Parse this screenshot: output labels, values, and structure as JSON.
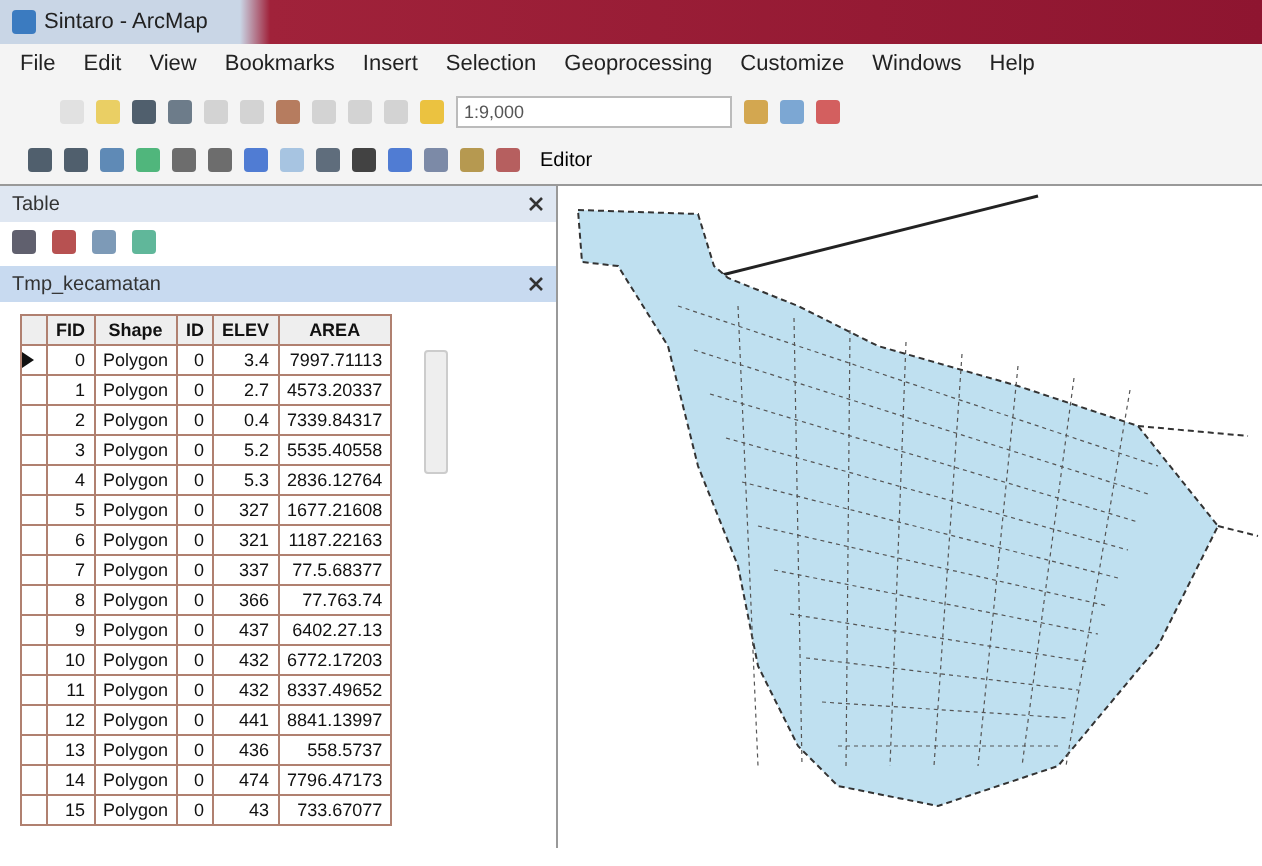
{
  "window": {
    "title": "Sintaro - ArcMap"
  },
  "menu": [
    "File",
    "Edit",
    "View",
    "Bookmarks",
    "Insert",
    "Selection",
    "Geoprocessing",
    "Customize",
    "Windows",
    "Help"
  ],
  "toolbar": {
    "scale": "1:9,000",
    "editor": "Editor"
  },
  "table_window": {
    "title": "Table",
    "tab": "Tmp_kecamatan",
    "columns": [
      "FID",
      "Shape",
      "ID",
      "ELEV",
      "AREA"
    ],
    "rows": [
      {
        "current": true,
        "cells": [
          "0",
          "Polygon",
          "0",
          "3.4",
          "7997.71113"
        ]
      },
      {
        "current": false,
        "cells": [
          "1",
          "Polygon",
          "0",
          "2.7",
          "4573.20337"
        ]
      },
      {
        "current": false,
        "cells": [
          "2",
          "Polygon",
          "0",
          "0.4",
          "7339.84317"
        ]
      },
      {
        "current": false,
        "cells": [
          "3",
          "Polygon",
          "0",
          "5.2",
          "5535.40558"
        ]
      },
      {
        "current": false,
        "cells": [
          "4",
          "Polygon",
          "0",
          "5.3",
          "2836.12764"
        ]
      },
      {
        "current": false,
        "cells": [
          "5",
          "Polygon",
          "0",
          "327",
          "1677.21608"
        ]
      },
      {
        "current": false,
        "cells": [
          "6",
          "Polygon",
          "0",
          "321",
          "1187.22163"
        ]
      },
      {
        "current": false,
        "cells": [
          "7",
          "Polygon",
          "0",
          "337",
          "77.5.68377"
        ]
      },
      {
        "current": false,
        "cells": [
          "8",
          "Polygon",
          "0",
          "366",
          "77.763.74"
        ]
      },
      {
        "current": false,
        "cells": [
          "9",
          "Polygon",
          "0",
          "437",
          "6402.27.13"
        ]
      },
      {
        "current": false,
        "cells": [
          "10",
          "Polygon",
          "0",
          "432",
          "6772.17203"
        ]
      },
      {
        "current": false,
        "cells": [
          "11",
          "Polygon",
          "0",
          "432",
          "8337.49652"
        ]
      },
      {
        "current": false,
        "cells": [
          "12",
          "Polygon",
          "0",
          "441",
          "8841.13997"
        ]
      },
      {
        "current": false,
        "cells": [
          "13",
          "Polygon",
          "0",
          "436",
          "558.5737"
        ]
      },
      {
        "current": false,
        "cells": [
          "14",
          "Polygon",
          "0",
          "474",
          "7796.47173"
        ]
      },
      {
        "current": false,
        "cells": [
          "15",
          "Polygon",
          "0",
          "43",
          "733.67077"
        ]
      }
    ]
  }
}
